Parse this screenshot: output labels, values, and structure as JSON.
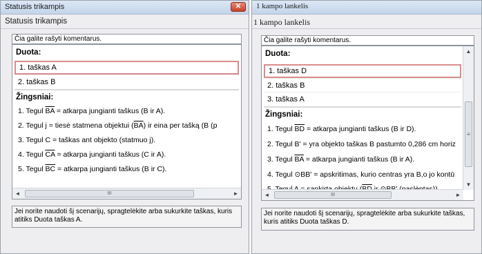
{
  "left_window": {
    "title": "Statusis trikampis",
    "close_symbol": "✕",
    "subtitle": "Statusis trikampis",
    "comment_placeholder": "Čia galite rašyti komentarus.",
    "given_header": "Duota:",
    "given": [
      "1. taškas A",
      "2. taškas B"
    ],
    "steps_header": "Žingsniai:",
    "steps": [
      {
        "pre": "1. Tegul ",
        "ov": "BA",
        "post": " = atkarpa jungianti taškus (B ir A)."
      },
      {
        "pre": "2. Tegul j = tiesė statmena objektui (",
        "ov": "BA",
        "post": ") ir eina per tašką (B (p"
      },
      {
        "pre": "3. Tegul C = taškas ant objekto (statmuo j).",
        "ov": "",
        "post": ""
      },
      {
        "pre": "4. Tegul ",
        "ov": "CA",
        "post": " = atkarpa jungianti taškus (C ir A)."
      },
      {
        "pre": "5. Tegul ",
        "ov": "BC",
        "post": " = atkarpa jungianti taškus (B ir C)."
      }
    ],
    "status_text": "Jei norite naudoti šį scenarijų, spragtelėkite arba sukurkite taškas, kuris atitiks Duota taškas A."
  },
  "right_window": {
    "title": "1 kampo lankelis",
    "subtitle": "1 kampo lankelis",
    "comment_placeholder": "Čia galite rašyti komentarus.",
    "given_header": "Duota:",
    "given": [
      "1. taškas D",
      "2. taškas B",
      "3. taškas A"
    ],
    "steps_header": "Žingsniai:",
    "steps": [
      {
        "pre": "1. Tegul ",
        "ov": "BD",
        "post": " = atkarpa jungianti taškus (B ir D)."
      },
      {
        "pre": "2. Tegul B' = yra objekto taškas B pastumto 0,286 cm horiz",
        "ov": "",
        "post": ""
      },
      {
        "pre": "3. Tegul ",
        "ov": "BA",
        "post": " = atkarpa jungianti taškus (B ir A)."
      },
      {
        "pre": "4. Tegul ⊙BB' = apskritimas, kurio centras yra B,o jo kontū",
        "ov": "",
        "post": ""
      },
      {
        "pre": "5. Tegul A = sankirta objektų (",
        "ov": "BD",
        "post": " ir ⊙BB' (paslėptas))."
      }
    ],
    "status_text": "Jei norite naudoti šį scenarijų, spragtelėkite arba sukurkite taškas, kuris atitiks Duota taškas D."
  },
  "scroll": {
    "left_arrow": "◄",
    "right_arrow": "►",
    "up_arrow": "▲",
    "down_arrow": "▼",
    "thumb_grip": "III",
    "vgrip": "≡"
  }
}
